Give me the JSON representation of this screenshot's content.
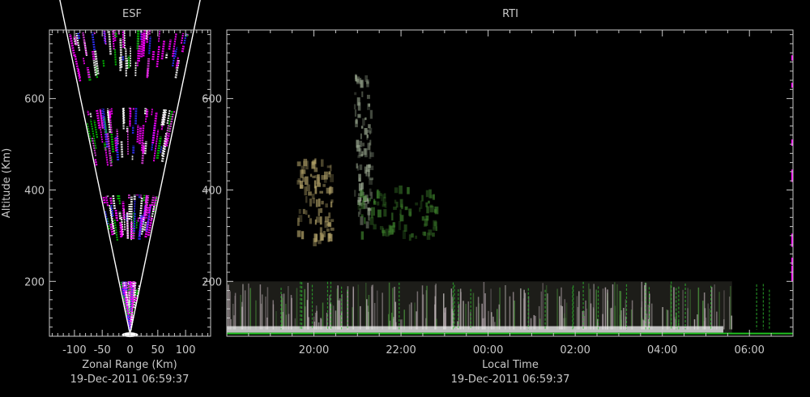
{
  "chart_data": [
    {
      "type": "heatmap",
      "title": "ESF",
      "xlabel": "Zonal Range (Km)",
      "ylabel": "Altitude (Km)",
      "timestamp": "19-Dec-2011 06:59:37",
      "xlim": [
        -145,
        145
      ],
      "ylim": [
        80,
        750
      ],
      "x_ticks": [
        -100,
        -50,
        0,
        50,
        100
      ],
      "x_tick_labels": [
        "-100",
        "-50",
        "0",
        "50",
        "100"
      ],
      "y_ticks": [
        200,
        400,
        600
      ],
      "y_tick_labels": [
        "200",
        "400",
        "600"
      ],
      "fan": {
        "apex_km": [
          0,
          85
        ],
        "half_angle_deg": 9.8,
        "range_max_km": 745
      },
      "echo_bands": [
        {
          "alt": [
            90,
            200
          ]
        },
        {
          "alt": [
            290,
            390
          ]
        },
        {
          "alt": [
            450,
            580
          ]
        },
        {
          "alt": [
            640,
            750
          ]
        }
      ],
      "grid": false
    },
    {
      "type": "heatmap",
      "title": "RTI",
      "xlabel": "Local Time",
      "ylabel": "Altitude (Km)",
      "timestamp": "19-Dec-2011 06:59:37",
      "xlim_hours": [
        18.0,
        31.0
      ],
      "ylim": [
        80,
        750
      ],
      "x_ticks": [
        20,
        22,
        24,
        26,
        28,
        30
      ],
      "x_tick_labels": [
        "20:00",
        "22:00",
        "00:00",
        "02:00",
        "04:00",
        "06:00"
      ],
      "y_ticks": [
        200,
        400,
        600
      ],
      "y_tick_labels": [
        "200",
        "400",
        "600"
      ],
      "features": [
        {
          "name": "plume-left",
          "t": [
            19.6,
            20.4
          ],
          "alt": [
            290,
            470
          ],
          "color": "#b4a46a"
        },
        {
          "name": "plume-column",
          "t": [
            20.9,
            21.3
          ],
          "alt": [
            330,
            660
          ],
          "color": "#9aa890"
        },
        {
          "name": "plume-arm",
          "t": [
            21.0,
            22.8
          ],
          "alt": [
            300,
            410
          ],
          "color": "#3a7a2a"
        },
        {
          "name": "bottomside-band",
          "t": [
            18.0,
            29.6
          ],
          "alt": [
            85,
            200
          ],
          "color": "#b8a8a8"
        }
      ],
      "grid": false
    }
  ]
}
